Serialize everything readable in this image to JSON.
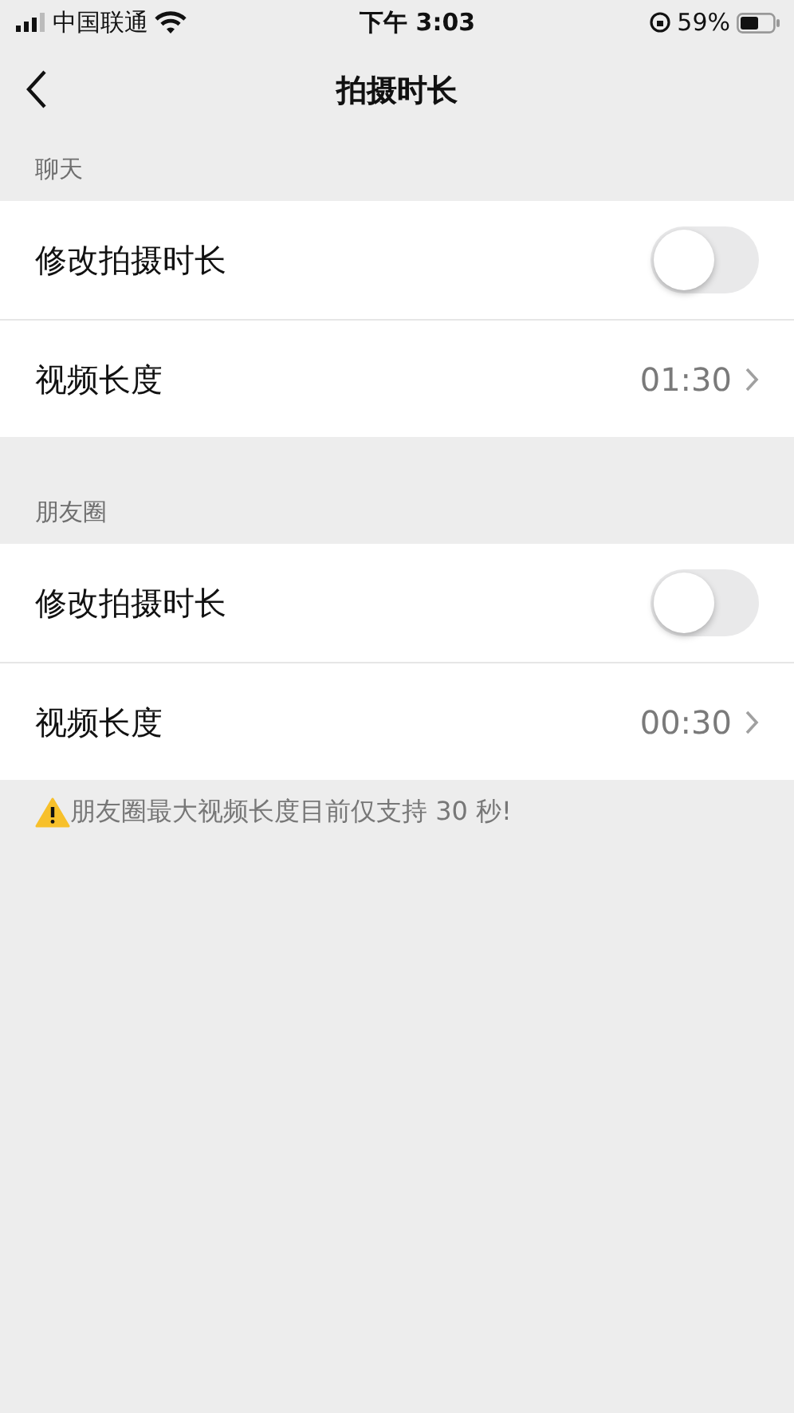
{
  "status_bar": {
    "carrier": "中国联通",
    "time": "下午 3:03",
    "battery": "59%"
  },
  "nav": {
    "title": "拍摄时长"
  },
  "sections": [
    {
      "header": "聊天",
      "rows": [
        {
          "kind": "toggle",
          "label": "修改拍摄时长",
          "on": false
        },
        {
          "kind": "value",
          "label": "视频长度",
          "value": "01:30"
        }
      ]
    },
    {
      "header": "朋友圈",
      "rows": [
        {
          "kind": "toggle",
          "label": "修改拍摄时长",
          "on": false
        },
        {
          "kind": "value",
          "label": "视频长度",
          "value": "00:30"
        }
      ]
    }
  ],
  "note": "朋友圈最大视频长度目前仅支持 30 秒!"
}
